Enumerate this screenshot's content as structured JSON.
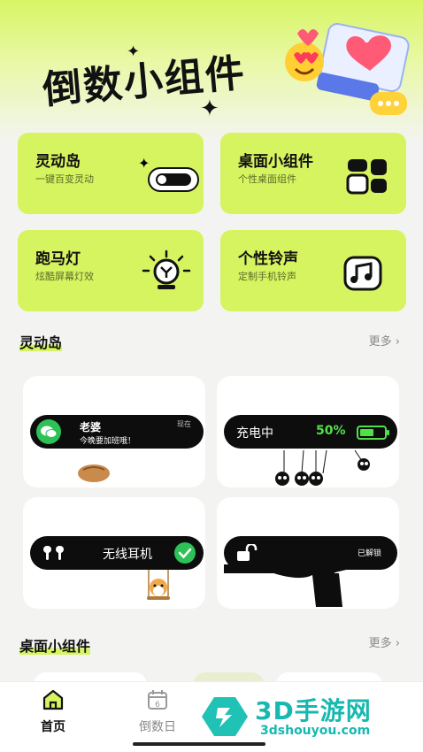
{
  "hero": {
    "title": "倒数小组件"
  },
  "features": [
    {
      "title": "灵动岛",
      "subtitle": "一键百变灵动"
    },
    {
      "title": "桌面小组件",
      "subtitle": "个性桌面组件"
    },
    {
      "title": "跑马灯",
      "subtitle": "炫酷屏幕灯效"
    },
    {
      "title": "个性铃声",
      "subtitle": "定制手机铃声"
    }
  ],
  "sections": {
    "island": {
      "title": "灵动岛",
      "more": "更多"
    },
    "widgets": {
      "title": "桌面小组件",
      "more": "更多"
    }
  },
  "island_cards": {
    "message": {
      "name": "老婆",
      "text": "今晚要加班哦！",
      "time": "现在"
    },
    "charging": {
      "label": "充电中",
      "percent": "50%"
    },
    "earphones": {
      "label": "无线耳机"
    },
    "unlock": {
      "label": "已解锁"
    }
  },
  "tabs": [
    {
      "label": "首页"
    },
    {
      "label": "倒数日"
    }
  ],
  "watermark": {
    "brand": "3D手游网",
    "domain": "3dshouyou.com"
  },
  "colors": {
    "accent": "#d6f360",
    "brand_teal": "#18b8b0",
    "charge_green": "#52e04a"
  }
}
